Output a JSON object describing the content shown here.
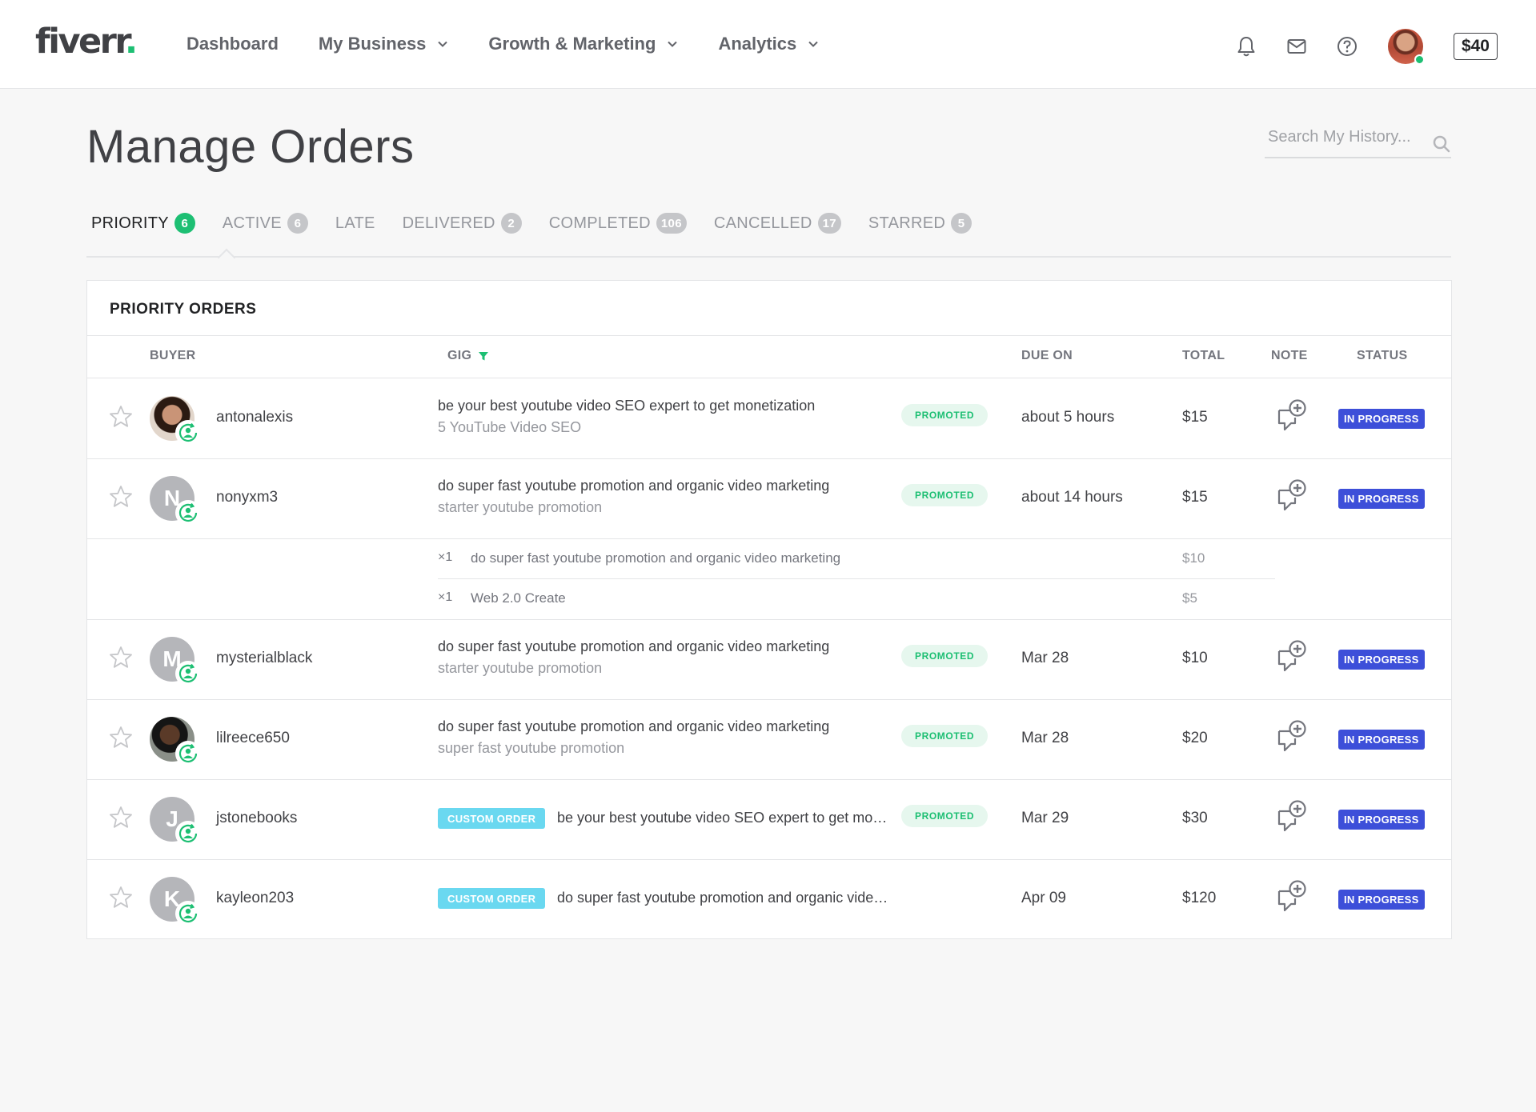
{
  "header": {
    "logo_text": "fiverr",
    "logo_dot": ".",
    "nav": [
      {
        "label": "Dashboard",
        "dropdown": false
      },
      {
        "label": "My Business",
        "dropdown": true
      },
      {
        "label": "Growth & Marketing",
        "dropdown": true
      },
      {
        "label": "Analytics",
        "dropdown": true
      }
    ],
    "icons": [
      "bell-icon",
      "envelope-icon",
      "help-icon"
    ],
    "balance": "$40"
  },
  "page": {
    "title": "Manage Orders",
    "search_placeholder": "Search My History..."
  },
  "tabs": [
    {
      "label": "PRIORITY",
      "count": "6",
      "active": true
    },
    {
      "label": "ACTIVE",
      "count": "6",
      "active": false
    },
    {
      "label": "LATE",
      "count": "",
      "active": false
    },
    {
      "label": "DELIVERED",
      "count": "2",
      "active": false
    },
    {
      "label": "COMPLETED",
      "count": "106",
      "active": false
    },
    {
      "label": "CANCELLED",
      "count": "17",
      "active": false
    },
    {
      "label": "STARRED",
      "count": "5",
      "active": false
    }
  ],
  "table": {
    "title": "PRIORITY ORDERS",
    "columns": {
      "buyer": "BUYER",
      "gig": "GIG",
      "due": "DUE ON",
      "total": "TOTAL",
      "note": "NOTE",
      "status": "STATUS"
    },
    "rows": [
      {
        "buyer": "antonalexis",
        "initial": "",
        "gig_title": "be your best youtube video SEO expert to get monetization",
        "gig_sub": "5 YouTube Video SEO",
        "custom": "",
        "promoted": "PROMOTED",
        "due": "about 5 hours",
        "total": "$15",
        "status": "IN PROGRESS"
      },
      {
        "buyer": "nonyxm3",
        "initial": "N",
        "gig_title": "do super fast youtube promotion and organic video marketing",
        "gig_sub": "starter youtube promotion",
        "custom": "",
        "promoted": "PROMOTED",
        "due": "about 14 hours",
        "total": "$15",
        "status": "IN PROGRESS"
      },
      {
        "buyer": "mysterialblack",
        "initial": "M",
        "gig_title": "do super fast youtube promotion and organic video marketing",
        "gig_sub": "starter youtube promotion",
        "custom": "",
        "promoted": "PROMOTED",
        "due": "Mar 28",
        "total": "$10",
        "status": "IN PROGRESS"
      },
      {
        "buyer": "lilreece650",
        "initial": "",
        "gig_title": "do super fast youtube promotion and organic video marketing",
        "gig_sub": "super fast youtube promotion",
        "custom": "",
        "promoted": "PROMOTED",
        "due": "Mar 28",
        "total": "$20",
        "status": "IN PROGRESS"
      },
      {
        "buyer": "jstonebooks",
        "initial": "J",
        "gig_title": "be your best youtube video SEO expert to get monetization",
        "gig_sub": "",
        "custom": "CUSTOM ORDER",
        "promoted": "PROMOTED",
        "due": "Mar 29",
        "total": "$30",
        "status": "IN PROGRESS"
      },
      {
        "buyer": "kayleon203",
        "initial": "K",
        "gig_title": "do super fast youtube promotion and organic video marketing",
        "gig_sub": "",
        "custom": "CUSTOM ORDER",
        "promoted": "",
        "due": "Apr 09",
        "total": "$120",
        "status": "IN PROGRESS"
      }
    ],
    "sub_items": [
      {
        "qty": "×1",
        "name": "do super fast youtube promotion and organic video marketing",
        "price": "$10"
      },
      {
        "qty": "×1",
        "name": "Web 2.0 Create",
        "price": "$5"
      }
    ]
  }
}
